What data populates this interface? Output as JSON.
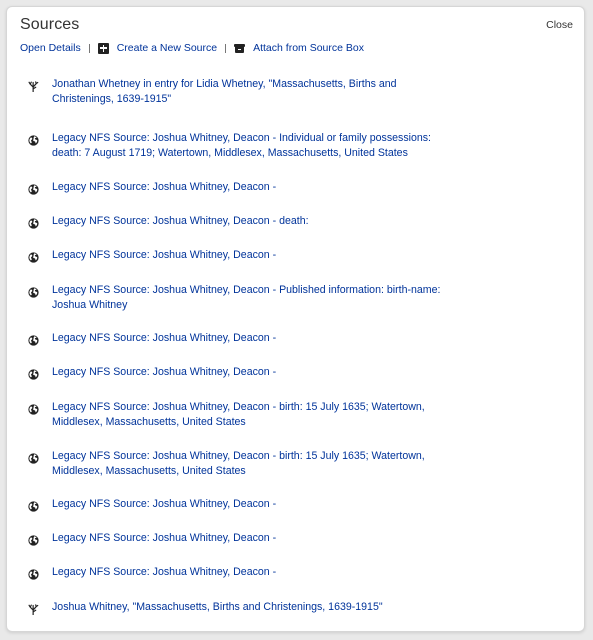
{
  "panel": {
    "title": "Sources",
    "close_label": "Close"
  },
  "toolbar": {
    "open_details": "Open Details",
    "create_new_source": "Create a New Source",
    "attach_from_source_box": "Attach from Source Box"
  },
  "sources": [
    {
      "icon": "tree-icon",
      "lines": [
        "Jonathan Whetney in entry for Lidia Whetney, \"Massachusetts, Births and",
        "Christenings, 1639-1915\""
      ]
    },
    {
      "icon": "globe-icon",
      "lines": [
        "Legacy NFS Source: Joshua Whitney, Deacon - Individual or family possessions:",
        "death: 7 August 1719; Watertown, Middlesex, Massachusetts, United States"
      ]
    },
    {
      "icon": "globe-icon",
      "lines": [
        "Legacy NFS Source: Joshua Whitney, Deacon -"
      ]
    },
    {
      "icon": "globe-icon",
      "lines": [
        "Legacy NFS Source: Joshua Whitney, Deacon - death:"
      ]
    },
    {
      "icon": "globe-icon",
      "lines": [
        "Legacy NFS Source: Joshua Whitney, Deacon -"
      ]
    },
    {
      "icon": "globe-icon",
      "lines": [
        "Legacy NFS Source: Joshua Whitney, Deacon - Published information: birth-name:",
        "Joshua Whitney"
      ]
    },
    {
      "icon": "globe-icon",
      "lines": [
        "Legacy NFS Source: Joshua Whitney, Deacon -"
      ]
    },
    {
      "icon": "globe-icon",
      "lines": [
        "Legacy NFS Source: Joshua Whitney, Deacon -"
      ]
    },
    {
      "icon": "globe-icon",
      "lines": [
        "Legacy NFS Source: Joshua Whitney, Deacon - birth: 15 July 1635; Watertown,",
        "Middlesex, Massachusetts, United States"
      ]
    },
    {
      "icon": "globe-icon",
      "lines": [
        "Legacy NFS Source: Joshua Whitney, Deacon - birth: 15 July 1635; Watertown,",
        "Middlesex, Massachusetts, United States"
      ]
    },
    {
      "icon": "globe-icon",
      "lines": [
        "Legacy NFS Source: Joshua Whitney, Deacon -"
      ]
    },
    {
      "icon": "globe-icon",
      "lines": [
        "Legacy NFS Source: Joshua Whitney, Deacon -"
      ]
    },
    {
      "icon": "globe-icon",
      "lines": [
        "Legacy NFS Source: Joshua Whitney, Deacon -"
      ]
    },
    {
      "icon": "tree-icon",
      "lines": [
        "Joshua Whitney, \"Massachusetts, Births and Christenings, 1639-1915\""
      ]
    }
  ],
  "colors": {
    "link": "#00339a",
    "text": "#333333",
    "icon": "#222222"
  }
}
